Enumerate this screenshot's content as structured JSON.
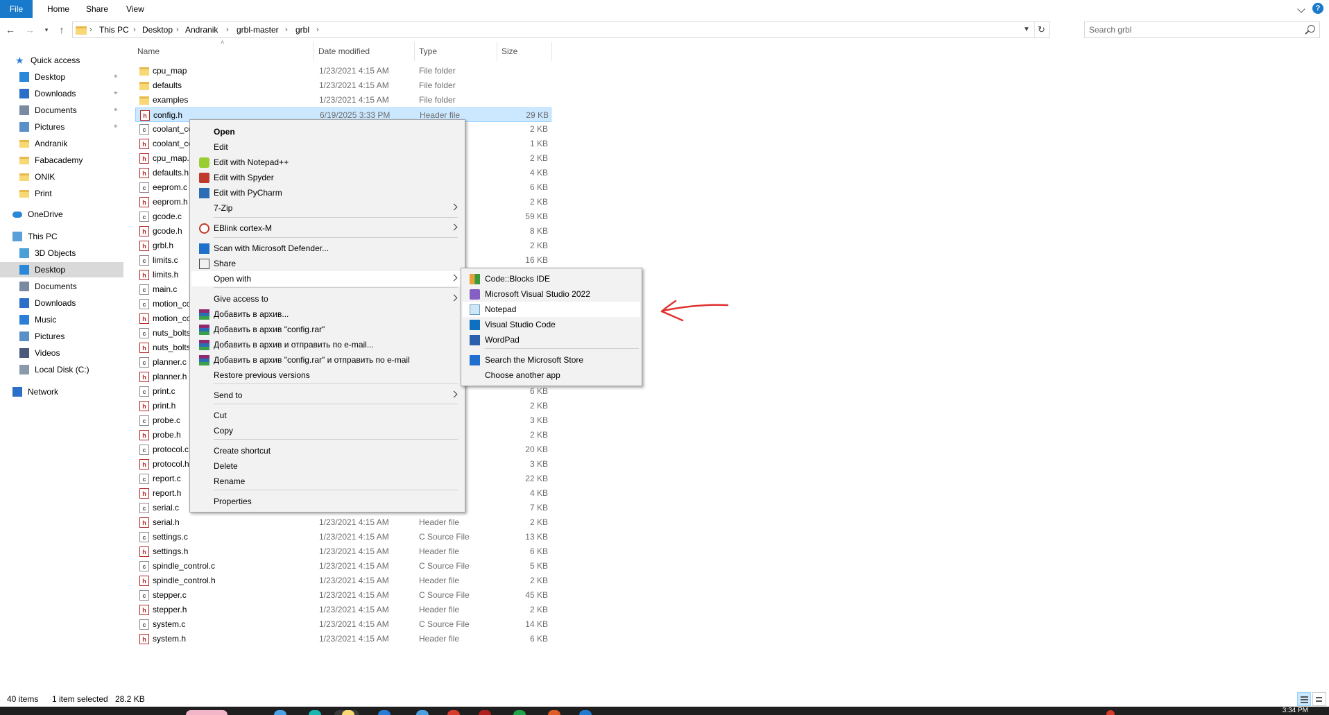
{
  "ribbon": {
    "tabs": [
      "File",
      "Home",
      "Share",
      "View"
    ]
  },
  "address": {
    "crumbs": [
      "This PC",
      "Desktop",
      "Andranik",
      "grbl-master",
      "grbl"
    ],
    "search_placeholder": "Search grbl"
  },
  "sidebar": {
    "items": [
      {
        "label": "Quick access",
        "icon": "star-icon"
      },
      {
        "label": "Desktop",
        "icon": "desktop-icon",
        "pinned": true
      },
      {
        "label": "Downloads",
        "icon": "download-icon",
        "pinned": true
      },
      {
        "label": "Documents",
        "icon": "documents-icon",
        "pinned": true
      },
      {
        "label": "Pictures",
        "icon": "pictures-icon",
        "pinned": true
      },
      {
        "label": "Andranik",
        "icon": "folder-icon"
      },
      {
        "label": "Fabacademy",
        "icon": "folder-icon"
      },
      {
        "label": "ONIK",
        "icon": "folder-icon"
      },
      {
        "label": "Print",
        "icon": "folder-icon"
      },
      {
        "label": "OneDrive",
        "icon": "cloud-icon"
      },
      {
        "label": "This PC",
        "icon": "computer-icon"
      },
      {
        "label": "3D Objects",
        "icon": "cube-icon"
      },
      {
        "label": "Desktop",
        "icon": "desktop-icon",
        "selected": true
      },
      {
        "label": "Documents",
        "icon": "documents-icon"
      },
      {
        "label": "Downloads",
        "icon": "download-icon"
      },
      {
        "label": "Music",
        "icon": "music-icon"
      },
      {
        "label": "Pictures",
        "icon": "pictures-icon"
      },
      {
        "label": "Videos",
        "icon": "videos-icon"
      },
      {
        "label": "Local Disk (C:)",
        "icon": "disk-icon"
      },
      {
        "label": "Network",
        "icon": "network-icon"
      }
    ]
  },
  "columns": {
    "name": "Name",
    "date": "Date modified",
    "type": "Type",
    "size": "Size"
  },
  "files": [
    {
      "name": "cpu_map",
      "date": "1/23/2021 4:15 AM",
      "type": "File folder",
      "size": "",
      "kind": "folder"
    },
    {
      "name": "defaults",
      "date": "1/23/2021 4:15 AM",
      "type": "File folder",
      "size": "",
      "kind": "folder"
    },
    {
      "name": "examples",
      "date": "1/23/2021 4:15 AM",
      "type": "File folder",
      "size": "",
      "kind": "folder"
    },
    {
      "name": "config.h",
      "date": "6/19/2025 3:33 PM",
      "type": "Header file",
      "size": "29 KB",
      "kind": "h",
      "selected": true
    },
    {
      "name": "coolant_co",
      "date": "",
      "type": "",
      "size": "2 KB",
      "kind": "c"
    },
    {
      "name": "coolant_co",
      "date": "",
      "type": "",
      "size": "1 KB",
      "kind": "h"
    },
    {
      "name": "cpu_map.h",
      "date": "",
      "type": "",
      "size": "2 KB",
      "kind": "h"
    },
    {
      "name": "defaults.h",
      "date": "",
      "type": "",
      "size": "4 KB",
      "kind": "h"
    },
    {
      "name": "eeprom.c",
      "date": "",
      "type": "",
      "size": "6 KB",
      "kind": "c"
    },
    {
      "name": "eeprom.h",
      "date": "",
      "type": "",
      "size": "2 KB",
      "kind": "h"
    },
    {
      "name": "gcode.c",
      "date": "",
      "type": "",
      "size": "59 KB",
      "kind": "c"
    },
    {
      "name": "gcode.h",
      "date": "",
      "type": "",
      "size": "8 KB",
      "kind": "h"
    },
    {
      "name": "grbl.h",
      "date": "",
      "type": "",
      "size": "2 KB",
      "kind": "h"
    },
    {
      "name": "limits.c",
      "date": "",
      "type": "",
      "size": "16 KB",
      "kind": "c"
    },
    {
      "name": "limits.h",
      "date": "",
      "type": "",
      "size": "",
      "kind": "h"
    },
    {
      "name": "main.c",
      "date": "",
      "type": "",
      "size": "",
      "kind": "c"
    },
    {
      "name": "motion_co",
      "date": "",
      "type": "",
      "size": "",
      "kind": "c"
    },
    {
      "name": "motion_co",
      "date": "",
      "type": "",
      "size": "",
      "kind": "h"
    },
    {
      "name": "nuts_bolts",
      "date": "",
      "type": "",
      "size": "",
      "kind": "c"
    },
    {
      "name": "nuts_bolts",
      "date": "",
      "type": "",
      "size": "",
      "kind": "h"
    },
    {
      "name": "planner.c",
      "date": "",
      "type": "",
      "size": "",
      "kind": "c"
    },
    {
      "name": "planner.h",
      "date": "",
      "type": "",
      "size": "",
      "kind": "h"
    },
    {
      "name": "print.c",
      "date": "",
      "type": "",
      "size": "6 KB",
      "kind": "c"
    },
    {
      "name": "print.h",
      "date": "",
      "type": "",
      "size": "2 KB",
      "kind": "h"
    },
    {
      "name": "probe.c",
      "date": "",
      "type": "",
      "size": "3 KB",
      "kind": "c"
    },
    {
      "name": "probe.h",
      "date": "",
      "type": "",
      "size": "2 KB",
      "kind": "h"
    },
    {
      "name": "protocol.c",
      "date": "",
      "type": "",
      "size": "20 KB",
      "kind": "c"
    },
    {
      "name": "protocol.h",
      "date": "",
      "type": "",
      "size": "3 KB",
      "kind": "h"
    },
    {
      "name": "report.c",
      "date": "",
      "type": "",
      "size": "22 KB",
      "kind": "c"
    },
    {
      "name": "report.h",
      "date": "",
      "type": "",
      "size": "4 KB",
      "kind": "h"
    },
    {
      "name": "serial.c",
      "date": "",
      "type": "",
      "size": "7 KB",
      "kind": "c"
    },
    {
      "name": "serial.h",
      "date": "1/23/2021 4:15 AM",
      "type": "Header file",
      "size": "2 KB",
      "kind": "h"
    },
    {
      "name": "settings.c",
      "date": "1/23/2021 4:15 AM",
      "type": "C Source File",
      "size": "13 KB",
      "kind": "c"
    },
    {
      "name": "settings.h",
      "date": "1/23/2021 4:15 AM",
      "type": "Header file",
      "size": "6 KB",
      "kind": "h"
    },
    {
      "name": "spindle_control.c",
      "date": "1/23/2021 4:15 AM",
      "type": "C Source File",
      "size": "5 KB",
      "kind": "c"
    },
    {
      "name": "spindle_control.h",
      "date": "1/23/2021 4:15 AM",
      "type": "Header file",
      "size": "2 KB",
      "kind": "h"
    },
    {
      "name": "stepper.c",
      "date": "1/23/2021 4:15 AM",
      "type": "C Source File",
      "size": "45 KB",
      "kind": "c"
    },
    {
      "name": "stepper.h",
      "date": "1/23/2021 4:15 AM",
      "type": "Header file",
      "size": "2 KB",
      "kind": "h"
    },
    {
      "name": "system.c",
      "date": "1/23/2021 4:15 AM",
      "type": "C Source File",
      "size": "14 KB",
      "kind": "c"
    },
    {
      "name": "system.h",
      "date": "1/23/2021 4:15 AM",
      "type": "Header file",
      "size": "6 KB",
      "kind": "h"
    }
  ],
  "context_menu": {
    "items": [
      {
        "label": "Open",
        "bold": true
      },
      {
        "label": "Edit"
      },
      {
        "label": "Edit with Notepad++",
        "icon": "notepadpp-icon"
      },
      {
        "label": "Edit with Spyder",
        "icon": "spyder-icon"
      },
      {
        "label": "Edit with PyCharm",
        "icon": "pycharm-icon"
      },
      {
        "label": "7-Zip",
        "submenu": true
      },
      {
        "label": "EBlink cortex-M",
        "icon": "eblink-icon",
        "submenu": true
      },
      {
        "label": "Scan with Microsoft Defender...",
        "icon": "defender-icon"
      },
      {
        "label": "Share",
        "icon": "share-icon"
      },
      {
        "label": "Open with",
        "submenu": true,
        "highlighted": true
      },
      {
        "label": "Give access to",
        "submenu": true
      },
      {
        "label": "Добавить в архив...",
        "icon": "winrar-icon"
      },
      {
        "label": "Добавить в архив \"config.rar\"",
        "icon": "winrar-icon"
      },
      {
        "label": "Добавить в архив и отправить по e-mail...",
        "icon": "winrar-icon"
      },
      {
        "label": "Добавить в архив \"config.rar\" и отправить по e-mail",
        "icon": "winrar-icon"
      },
      {
        "label": "Restore previous versions"
      },
      {
        "label": "Send to",
        "submenu": true
      },
      {
        "label": "Cut"
      },
      {
        "label": "Copy"
      },
      {
        "label": "Create shortcut"
      },
      {
        "label": "Delete"
      },
      {
        "label": "Rename"
      },
      {
        "label": "Properties"
      }
    ]
  },
  "open_with_menu": {
    "items": [
      {
        "label": "Code::Blocks IDE",
        "icon": "codeblocks-icon"
      },
      {
        "label": "Microsoft Visual Studio 2022",
        "icon": "visual-studio-icon"
      },
      {
        "label": "Notepad",
        "icon": "notepad-icon",
        "highlighted": true
      },
      {
        "label": "Visual Studio Code",
        "icon": "vscode-icon"
      },
      {
        "label": "WordPad",
        "icon": "wordpad-icon"
      },
      {
        "label": "Search the Microsoft Store",
        "icon": "store-icon"
      },
      {
        "label": "Choose another app"
      }
    ]
  },
  "status": {
    "items": "40 items",
    "selection": "1 item selected",
    "size": "28.2 KB"
  },
  "taskbar": {
    "clock": "3:34 PM"
  },
  "colors": {
    "accent": "#1979ca",
    "selection": "#cce8ff",
    "annotation_arrow": "#e03030"
  }
}
